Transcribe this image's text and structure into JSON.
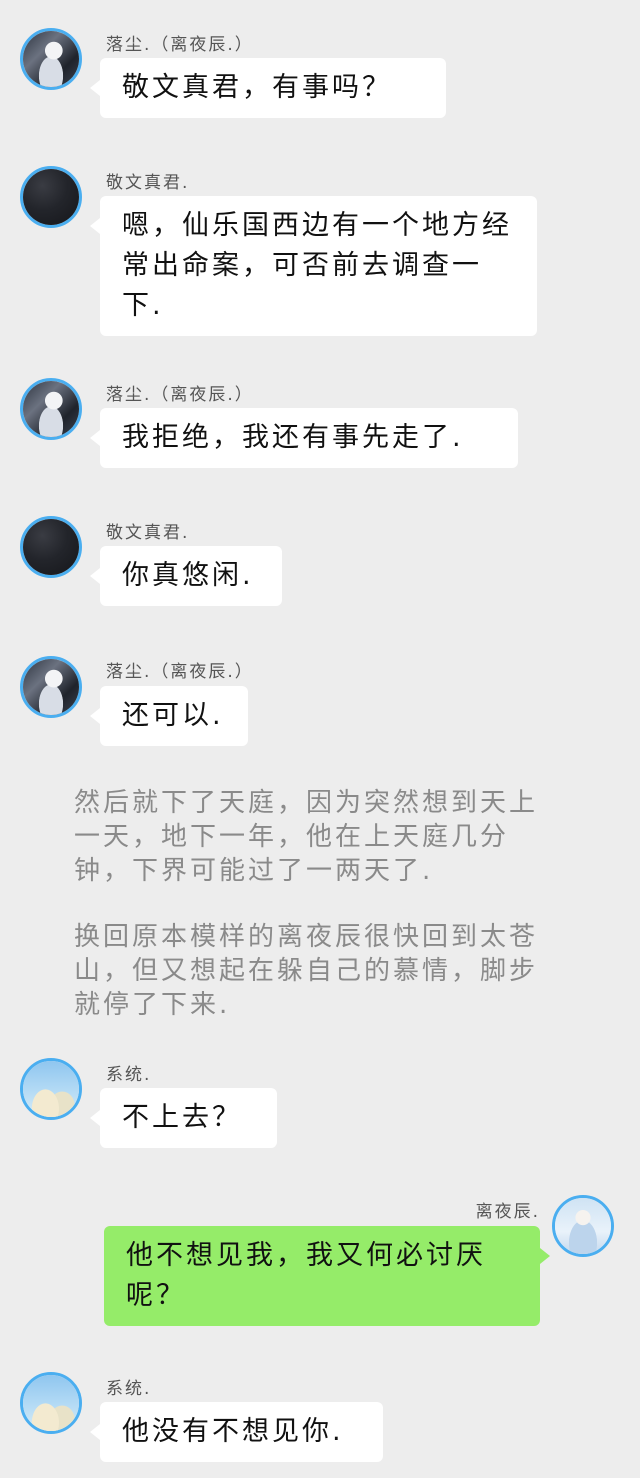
{
  "messages": [
    {
      "sender": "落尘.（离夜辰.）",
      "text": "敬文真君，有事吗？"
    },
    {
      "sender": "敬文真君.",
      "text": "嗯，仙乐国西边有一个地方经常出命案，可否前去调查一下."
    },
    {
      "sender": "落尘.（离夜辰.）",
      "text": "我拒绝，我还有事先走了."
    },
    {
      "sender": "敬文真君.",
      "text": "你真悠闲."
    },
    {
      "sender": "落尘.（离夜辰.）",
      "text": "还可以."
    },
    {
      "sender": "系统.",
      "text": "不上去？"
    },
    {
      "sender": "离夜辰.",
      "text": "他不想见我，我又何必讨厌呢？"
    },
    {
      "sender": "系统.",
      "text": "他没有不想见你."
    }
  ],
  "narration": [
    "然后就下了天庭，因为突然想到天上一天，地下一年，他在上天庭几分钟，下界可能过了一两天了.",
    "换回原本模样的离夜辰很快回到太苍山，但又想起在躲自己的慕情，脚步就停了下来."
  ],
  "avatars": {
    "luochen": "avatar-ink-portrait",
    "jingwen": "avatar-dark",
    "system": "avatar-sky-clouds",
    "liyechen": "avatar-angel-portrait"
  },
  "colors": {
    "background": "#ededed",
    "bubble_left": "#ffffff",
    "bubble_right": "#95ec69",
    "avatar_ring": "#4aaef0"
  }
}
